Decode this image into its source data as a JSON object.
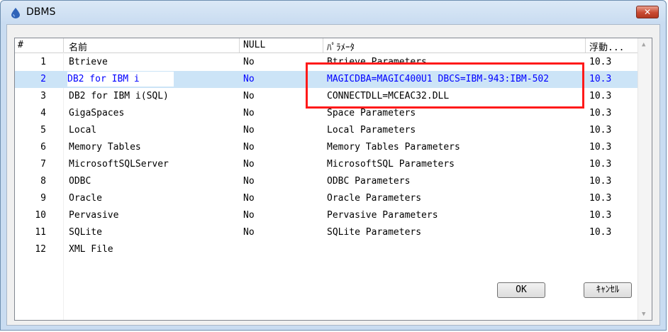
{
  "window": {
    "title": "DBMS",
    "close_label": "✕"
  },
  "table": {
    "columns": [
      "#",
      "名前",
      "NULL",
      "ﾊﾟﾗﾒｰﾀ",
      "浮動..."
    ],
    "rows": [
      {
        "num": "1",
        "name": "Btrieve",
        "null": "No",
        "param": "Btrieve Parameters",
        "float": "10.3"
      },
      {
        "num": "2",
        "name": "DB2 for IBM i",
        "null": "No",
        "param": "MAGICDBA=MAGIC400U1 DBCS=IBM-943:IBM-502",
        "float": "10.3"
      },
      {
        "num": "3",
        "name": "DB2 for IBM i(SQL)",
        "null": "No",
        "param": "CONNECTDLL=MCEAC32.DLL",
        "float": "10.3"
      },
      {
        "num": "4",
        "name": "GigaSpaces",
        "null": "No",
        "param": "Space Parameters",
        "float": "10.3"
      },
      {
        "num": "5",
        "name": "Local",
        "null": "No",
        "param": "Local Parameters",
        "float": "10.3"
      },
      {
        "num": "6",
        "name": "Memory Tables",
        "null": "No",
        "param": "Memory Tables Parameters",
        "float": "10.3"
      },
      {
        "num": "7",
        "name": "MicrosoftSQLServer",
        "null": "No",
        "param": "MicrosoftSQL Parameters",
        "float": "10.3"
      },
      {
        "num": "8",
        "name": "ODBC",
        "null": "No",
        "param": "ODBC Parameters",
        "float": "10.3"
      },
      {
        "num": "9",
        "name": "Oracle",
        "null": "No",
        "param": "Oracle Parameters",
        "float": "10.3"
      },
      {
        "num": "10",
        "name": "Pervasive",
        "null": "No",
        "param": "Pervasive Parameters",
        "float": "10.3"
      },
      {
        "num": "11",
        "name": "SQLite",
        "null": "No",
        "param": "SQLite Parameters",
        "float": "10.3"
      },
      {
        "num": "12",
        "name": "XML File",
        "null": "",
        "param": "",
        "float": ""
      }
    ],
    "selected_row": 2
  },
  "buttons": {
    "ok_label": "OK",
    "cancel_label": "ｷｬﾝｾﾙ"
  },
  "colors": {
    "selection": "#cce4f7",
    "selected_text": "#0000ff",
    "annotation": "#ff1a1a"
  },
  "icons": {
    "app": "blue-drop-icon",
    "scroll_up": "chevron-up-icon",
    "scroll_down": "chevron-down-icon"
  }
}
